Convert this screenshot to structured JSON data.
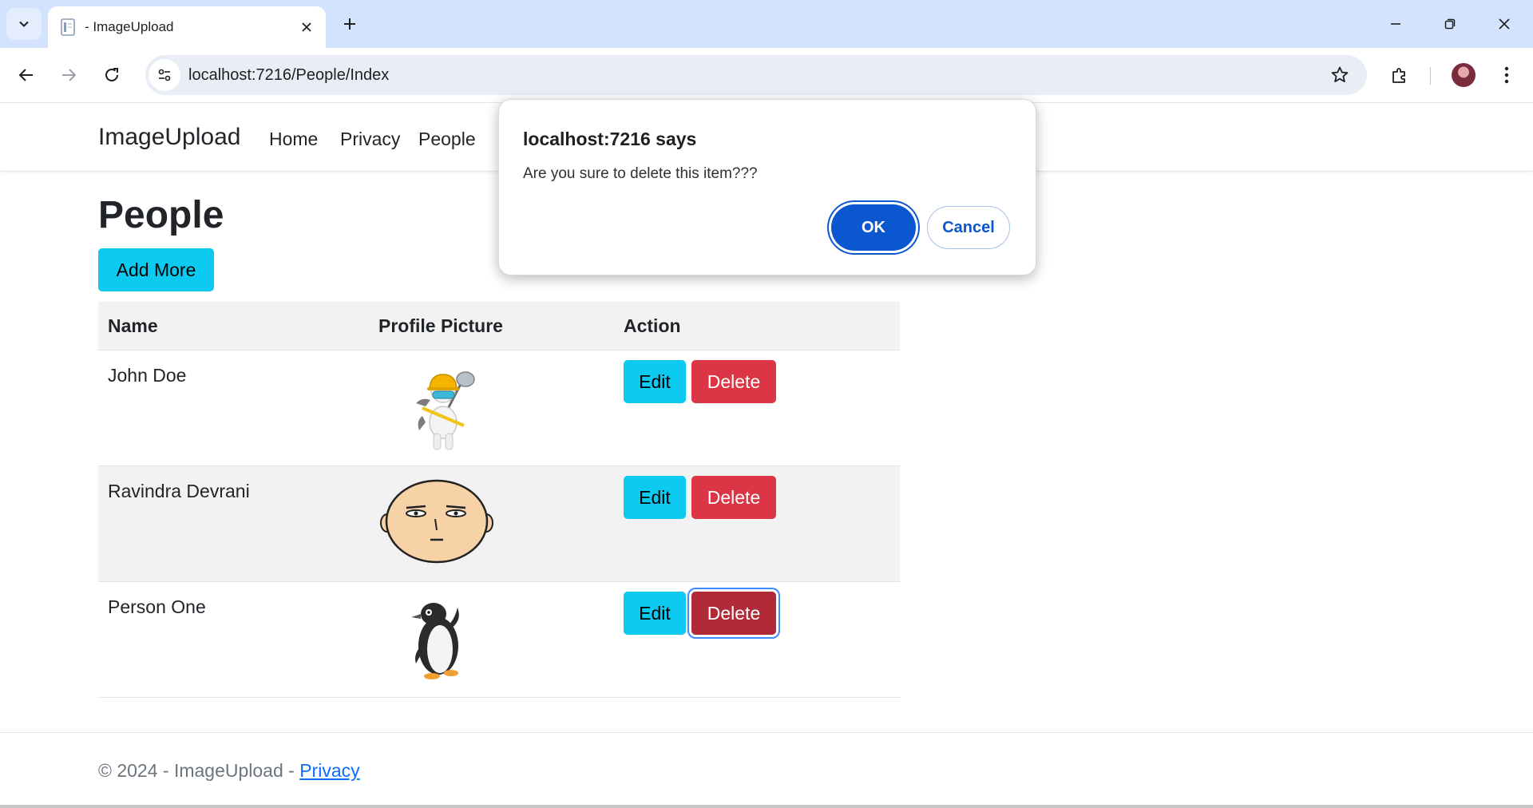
{
  "browser": {
    "tab_title": "- ImageUpload",
    "url": "localhost:7216/People/Index"
  },
  "site": {
    "brand": "ImageUpload",
    "nav": [
      "Home",
      "Privacy",
      "People"
    ]
  },
  "page": {
    "title": "People",
    "add_button": "Add More",
    "columns": [
      "Name",
      "Profile Picture",
      "Action"
    ],
    "rows": [
      {
        "name": "John Doe",
        "picture": "construction-worker-icon",
        "edit": "Edit",
        "delete": "Delete"
      },
      {
        "name": "Ravindra Devrani",
        "picture": "bald-face-icon",
        "edit": "Edit",
        "delete": "Delete"
      },
      {
        "name": "Person One",
        "picture": "penguin-icon",
        "edit": "Edit",
        "delete": "Delete"
      }
    ]
  },
  "footer": {
    "text": "© 2024 - ImageUpload - ",
    "link": "Privacy"
  },
  "dialog": {
    "title": "localhost:7216 says",
    "message": "Are you sure to delete this item???",
    "ok": "OK",
    "cancel": "Cancel"
  },
  "colors": {
    "info": "#0dcaf0",
    "danger": "#dc3545",
    "dialog_primary": "#0b57d0",
    "tabstrip": "#d3e3fd"
  }
}
